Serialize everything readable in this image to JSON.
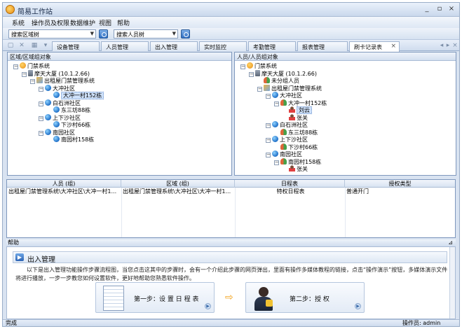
{
  "window": {
    "title": "简易工作站",
    "controls": [
      "_",
      "▫",
      "×"
    ]
  },
  "menu": [
    "系统",
    "操作员及权限",
    "数据维护",
    "视图",
    "帮助"
  ],
  "search": {
    "area_placeholder": "搜索区域树",
    "person_placeholder": "搜索人员树"
  },
  "tabs": [
    "设备管理",
    "人员管理",
    "出入管理",
    "实时监控",
    "考勤管理",
    "报表管理",
    "刷卡记录表"
  ],
  "tab_nav": [
    "◂",
    "▸",
    "×"
  ],
  "left_panel": {
    "title": "区域/区域组对象",
    "nodes": [
      {
        "toggle": "−",
        "icon": "door",
        "label": "门禁系统"
      },
      {
        "toggle": "−",
        "icon": "pc",
        "label": "摩天大厦 (10.1.2.66)"
      },
      {
        "toggle": "−",
        "icon": "sys",
        "label": "出租屋门禁管理系统"
      },
      {
        "toggle": "−",
        "icon": "globe",
        "label": "大冲社区"
      },
      {
        "toggle": "",
        "icon": "globe",
        "label": "大冲一村152栋",
        "selected": true
      },
      {
        "toggle": "−",
        "icon": "globe",
        "label": "白石洲社区"
      },
      {
        "toggle": "",
        "icon": "globe",
        "label": "东三坊88栋"
      },
      {
        "toggle": "−",
        "icon": "globe",
        "label": "上下沙社区"
      },
      {
        "toggle": "",
        "icon": "globe",
        "label": "下沙村66栋"
      },
      {
        "toggle": "−",
        "icon": "globe",
        "label": "南园社区"
      },
      {
        "toggle": "",
        "icon": "globe",
        "label": "南园村158栋"
      }
    ]
  },
  "right_panel": {
    "title": "人员/人员组对象",
    "nodes": [
      {
        "toggle": "−",
        "icon": "door",
        "label": "门禁系统"
      },
      {
        "toggle": "−",
        "icon": "pc",
        "label": "摩天大厦 (10.1.2.66)"
      },
      {
        "toggle": "",
        "icon": "people",
        "label": "未分组人员"
      },
      {
        "toggle": "−",
        "icon": "sys",
        "label": "出租屋门禁管理系统"
      },
      {
        "toggle": "−",
        "icon": "globe",
        "label": "大冲社区"
      },
      {
        "toggle": "−",
        "icon": "people",
        "label": "大冲一村152栋"
      },
      {
        "toggle": "",
        "icon": "person",
        "label": "刘云",
        "selected": true
      },
      {
        "toggle": "",
        "icon": "person",
        "label": "张关"
      },
      {
        "toggle": "−",
        "icon": "globe",
        "label": "白石洲社区"
      },
      {
        "toggle": "",
        "icon": "people",
        "label": "东三坊88栋"
      },
      {
        "toggle": "−",
        "icon": "globe",
        "label": "上下沙社区"
      },
      {
        "toggle": "",
        "icon": "people",
        "label": "下沙村66栋"
      },
      {
        "toggle": "−",
        "icon": "globe",
        "label": "南园社区"
      },
      {
        "toggle": "−",
        "icon": "people",
        "label": "南园村158栋"
      },
      {
        "toggle": "",
        "icon": "person",
        "label": "张关"
      }
    ]
  },
  "grid": {
    "headers": [
      "人员 (组)",
      "区域 (组)",
      "日程表",
      "授权类型"
    ],
    "rows": [
      [
        "出租屋门禁管理系统\\大冲社区\\大冲一村1...",
        "出租屋门禁管理系统\\大冲社区\\大冲一村1...",
        "特权日程表",
        "普通开门"
      ]
    ]
  },
  "help": {
    "bar_label": "帮助",
    "title": "出入管理",
    "text": "以下是出入管理功能操作步骤流程图，当您点击这其中的步骤时，会有一个介绍此步骤的网页弹出，里面有操作多媒体教程的链接，点击“操作演示”按钮，多媒体演示文件将进行播放，一步一步教您如何设置软件，更好地帮助您熟悉软件操作。",
    "step1": "第一步：设 置 日 程 表",
    "step2": "第二步：授    权",
    "arrow": "⇨"
  },
  "status": {
    "left": "完成",
    "right": "操作员: admin"
  }
}
